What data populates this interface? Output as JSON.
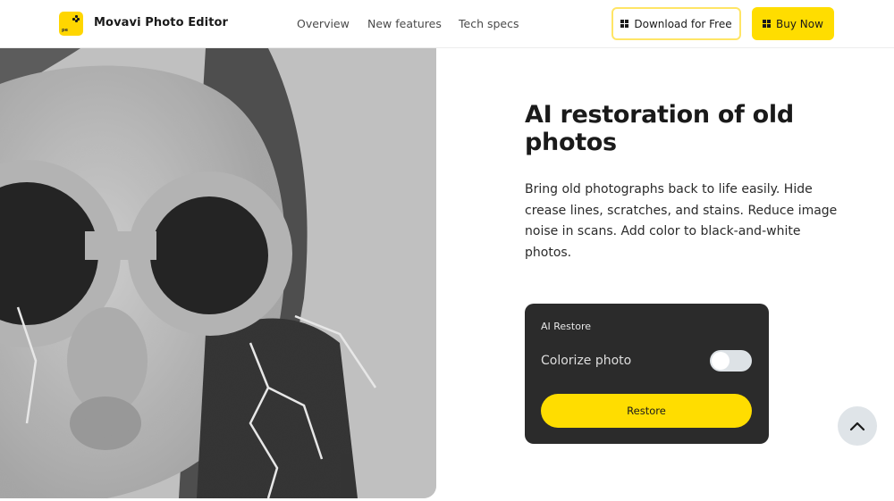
{
  "header": {
    "brand": "Movavi Photo Editor",
    "logo_icon": "movavi-photo-editor-logo",
    "logo_caption": "pe",
    "nav": [
      {
        "label": "Overview"
      },
      {
        "label": "New features"
      },
      {
        "label": "Tech specs"
      }
    ],
    "download_label": "Download for Free",
    "buy_label": "Buy Now",
    "button_icon": "windows-icon"
  },
  "hero": {
    "image_alt": "Black-and-white portrait of a woman in round sunglasses with crease lines and scratches",
    "title": "AI restoration of old photos",
    "description": "Bring old photographs back to life easily. Hide crease lines, scratches, and stains. Reduce image noise in scans. Add color to black-and-white photos."
  },
  "panel": {
    "title": "AI Restore",
    "colorize_label": "Colorize photo",
    "colorize_on": false,
    "restore_label": "Restore"
  },
  "scroll_top_icon": "chevron-up-icon",
  "colors": {
    "accent": "#ffdd00",
    "panel_bg": "#2b2b2b",
    "toggle_off": "#dde2e6",
    "scroll_btn": "#dfe4e8"
  }
}
